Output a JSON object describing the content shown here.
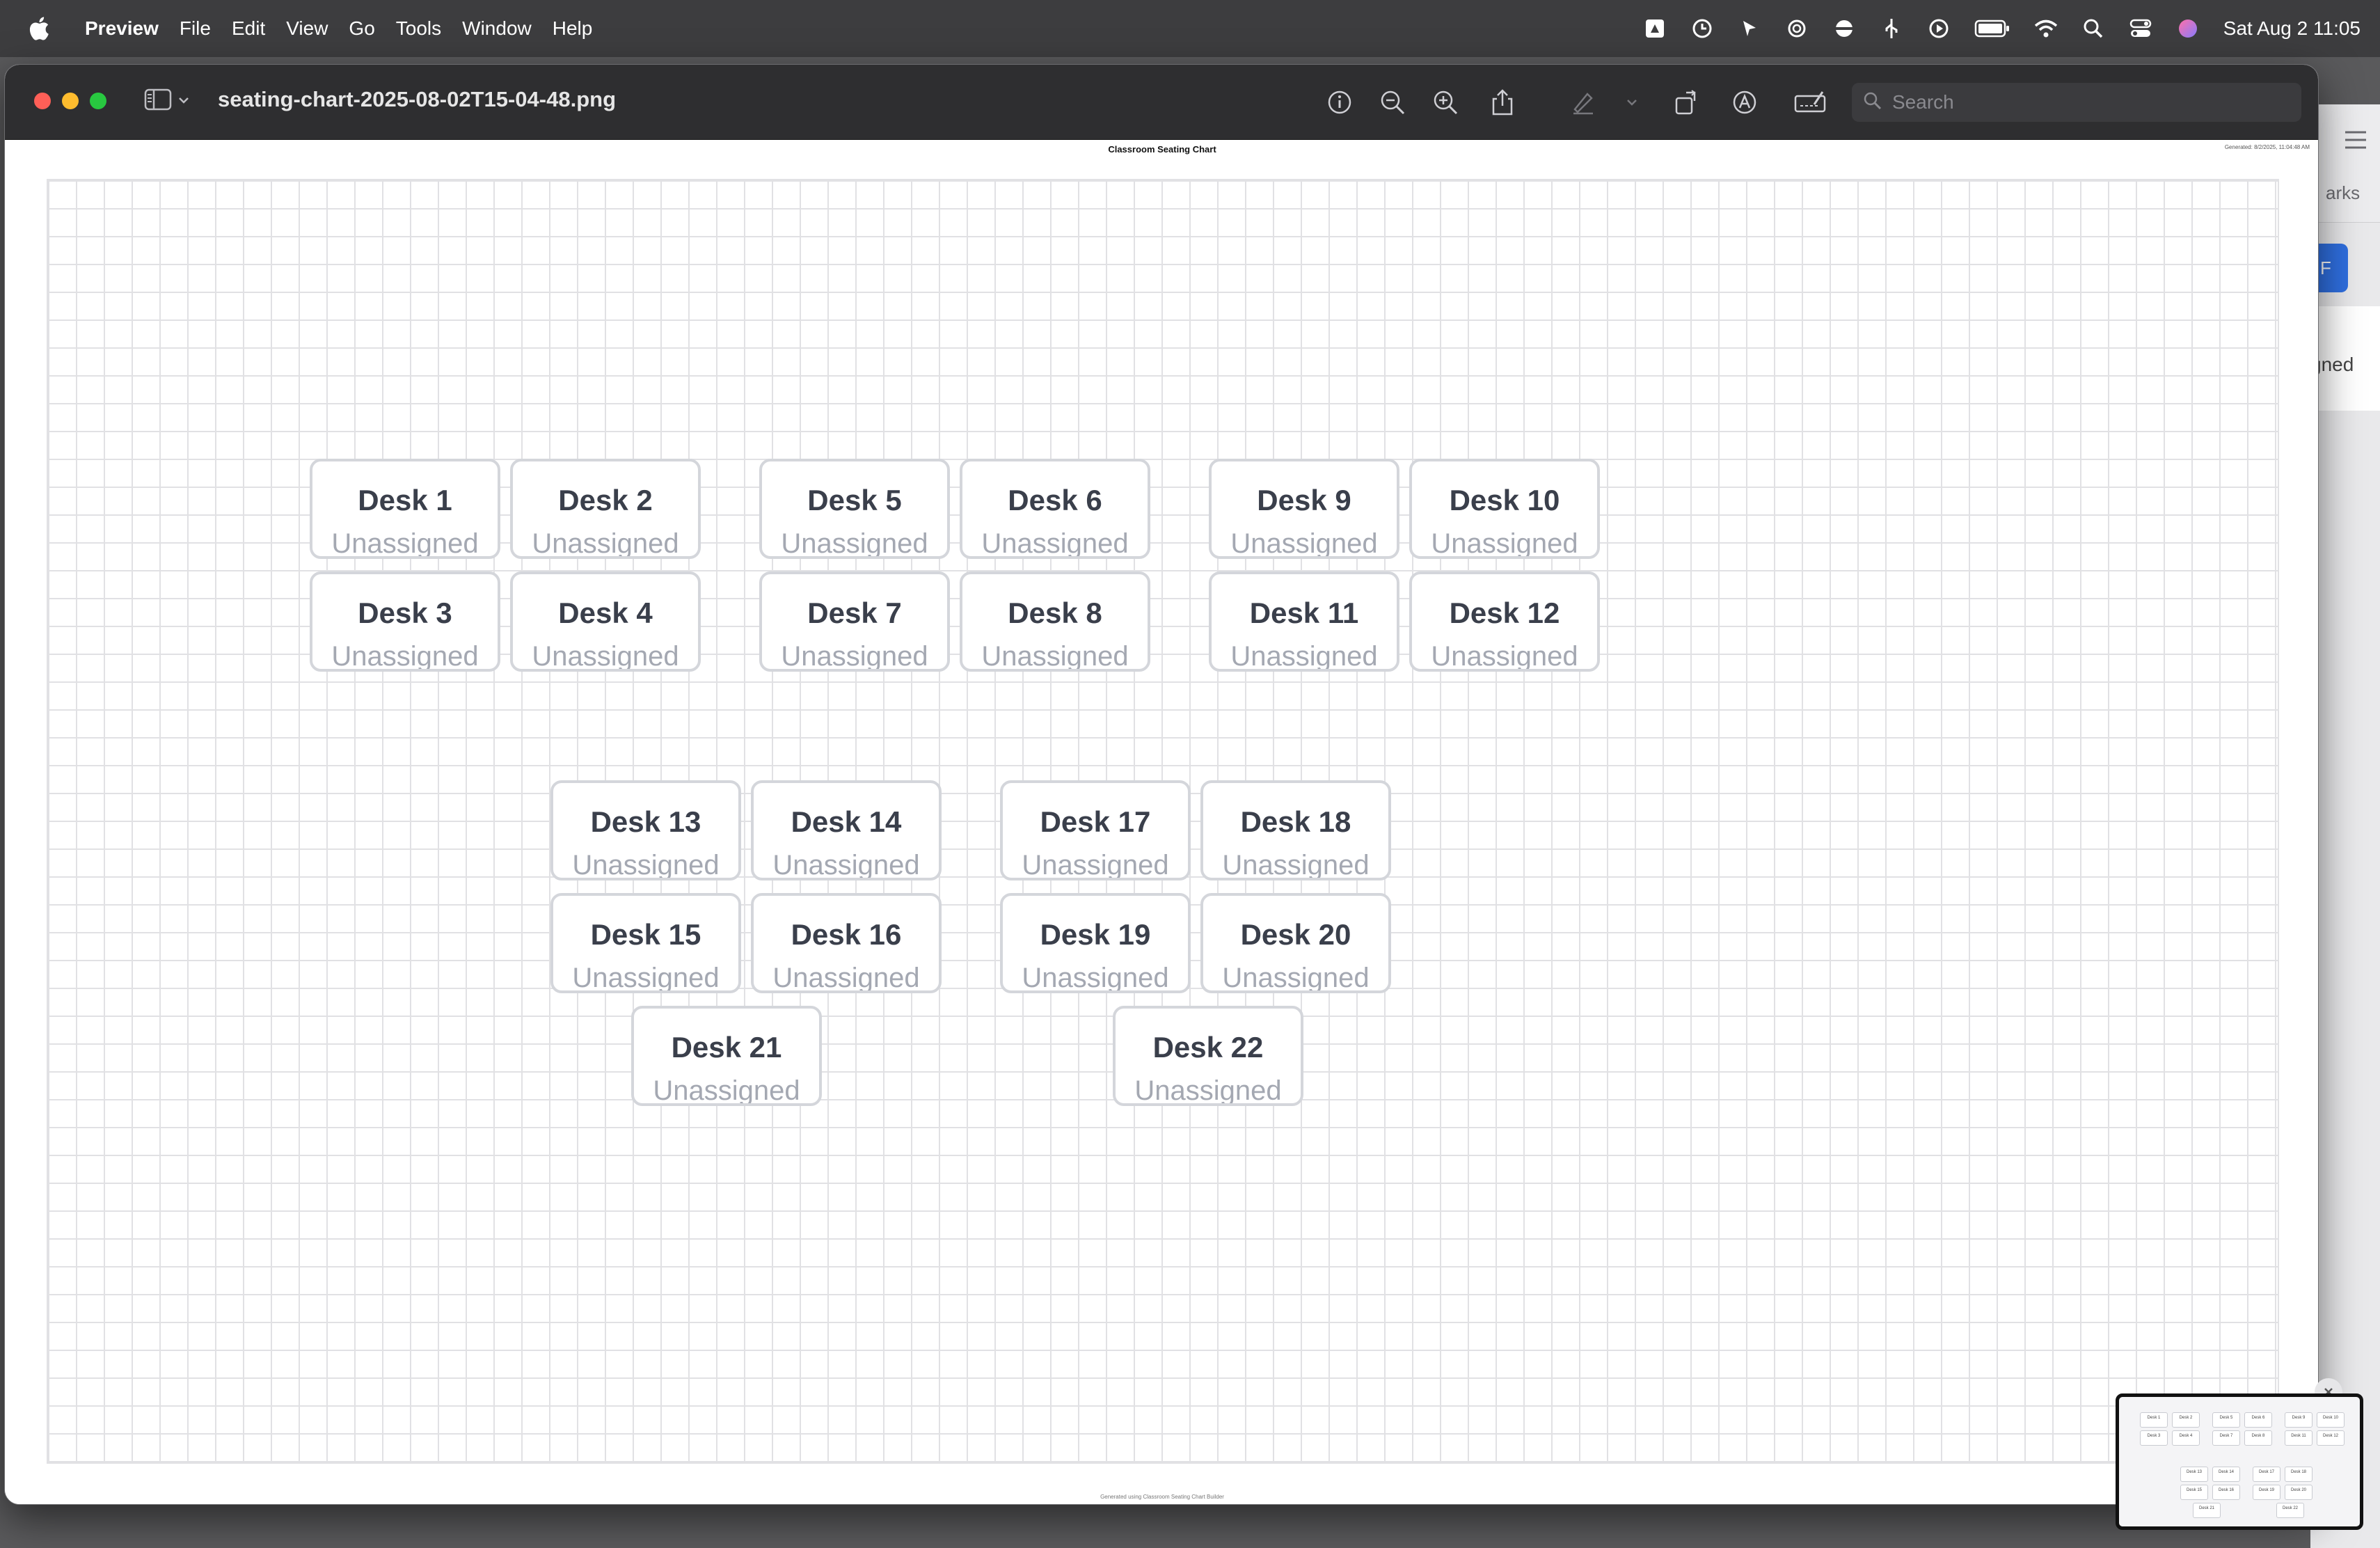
{
  "menubar": {
    "app_name": "Preview",
    "menus": [
      "File",
      "Edit",
      "View",
      "Go",
      "Tools",
      "Window",
      "Help"
    ],
    "clock": "Sat Aug 2  11:05"
  },
  "window": {
    "title": "seating-chart-2025-08-02T15-04-48.png",
    "search_placeholder": "Search"
  },
  "document": {
    "title": "Classroom Seating Chart",
    "generated_stamp": "Generated: 8/2/2025, 11:04:48 AM",
    "footer": "Generated using Classroom Seating Chart Builder"
  },
  "desks": [
    {
      "name": "Desk 1",
      "student": "Unassigned"
    },
    {
      "name": "Desk 2",
      "student": "Unassigned"
    },
    {
      "name": "Desk 3",
      "student": "Unassigned"
    },
    {
      "name": "Desk 4",
      "student": "Unassigned"
    },
    {
      "name": "Desk 5",
      "student": "Unassigned"
    },
    {
      "name": "Desk 6",
      "student": "Unassigned"
    },
    {
      "name": "Desk 7",
      "student": "Unassigned"
    },
    {
      "name": "Desk 8",
      "student": "Unassigned"
    },
    {
      "name": "Desk 9",
      "student": "Unassigned"
    },
    {
      "name": "Desk 10",
      "student": "Unassigned"
    },
    {
      "name": "Desk 11",
      "student": "Unassigned"
    },
    {
      "name": "Desk 12",
      "student": "Unassigned"
    },
    {
      "name": "Desk 13",
      "student": "Unassigned"
    },
    {
      "name": "Desk 14",
      "student": "Unassigned"
    },
    {
      "name": "Desk 15",
      "student": "Unassigned"
    },
    {
      "name": "Desk 16",
      "student": "Unassigned"
    },
    {
      "name": "Desk 17",
      "student": "Unassigned"
    },
    {
      "name": "Desk 18",
      "student": "Unassigned"
    },
    {
      "name": "Desk 19",
      "student": "Unassigned"
    },
    {
      "name": "Desk 20",
      "student": "Unassigned"
    },
    {
      "name": "Desk 21",
      "student": "Unassigned"
    },
    {
      "name": "Desk 22",
      "student": "Unassigned"
    }
  ],
  "background_app": {
    "marks_fragment": "arks",
    "button_fragment": "F",
    "assigned_fragment": "gned"
  },
  "colors": {
    "menubar": "#3d3d3f",
    "titlebar": "#2e2e30",
    "desk_border": "#d4d6db",
    "desk_name": "#3a3f4b",
    "desk_student": "#a4a8b2",
    "close": "#ff5f57",
    "minimize": "#febc2e",
    "zoom": "#28c840"
  }
}
